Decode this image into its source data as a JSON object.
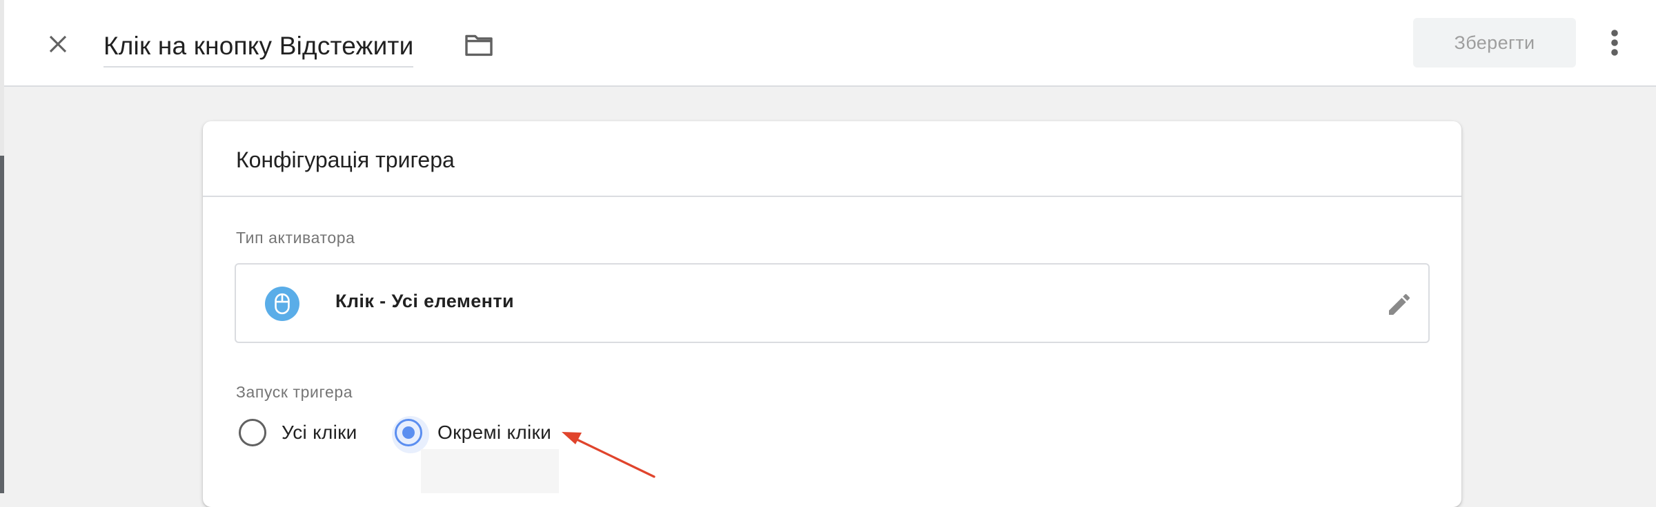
{
  "header": {
    "title": "Клік на кнопку Відстежити",
    "save_label": "Зберегти",
    "icons": {
      "close": "close-icon",
      "folder": "folder-icon",
      "more": "more-vert-icon"
    }
  },
  "card": {
    "title": "Конфігурація тригера",
    "activator": {
      "section_label": "Тип активатора",
      "type_label": "Клік - Усі елементи",
      "icon": "mouse-icon",
      "edit_icon": "pencil-icon"
    },
    "trigger_launch": {
      "section_label": "Запуск тригера",
      "options": [
        {
          "label": "Усі кліки",
          "selected": false
        },
        {
          "label": "Окремі кліки",
          "selected": true
        }
      ]
    }
  },
  "annotation": {
    "arrow_color": "#e0442c"
  },
  "colors": {
    "accent": "#5b8ff0",
    "mouse_icon_bg": "#5aade8",
    "background": "#f1f1f1"
  }
}
